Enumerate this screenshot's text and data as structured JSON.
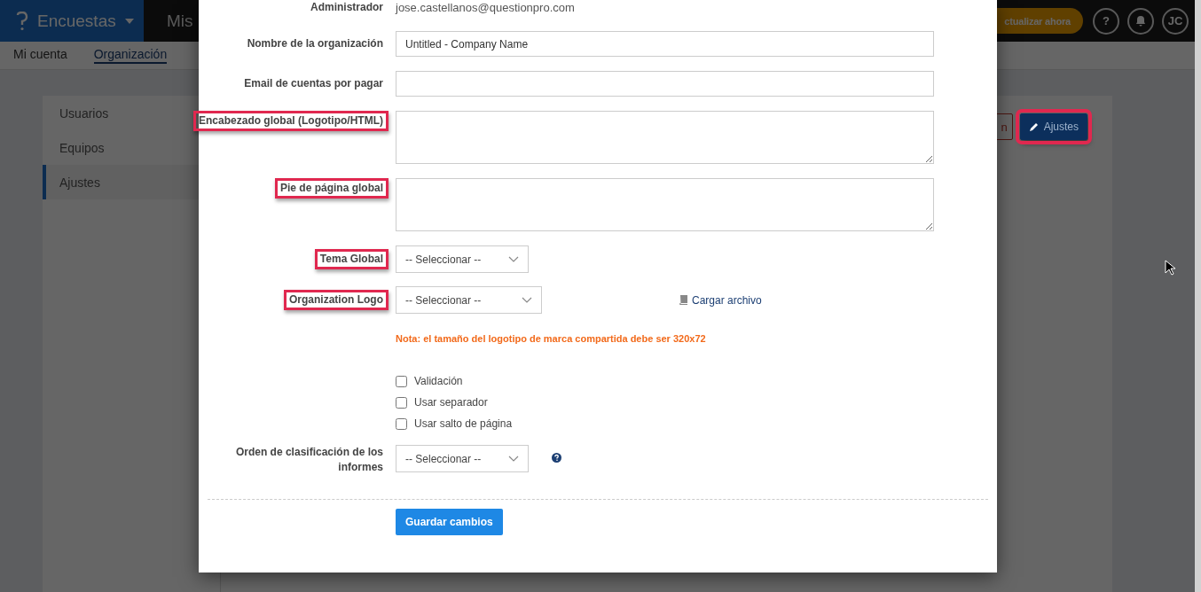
{
  "topbar": {
    "product": "Encuestas",
    "section": "Mis",
    "upgrade": "ctualizar ahora",
    "help": "?",
    "avatar": "JC"
  },
  "subnav": [
    {
      "label": "Mi cuenta",
      "selected": false
    },
    {
      "label": "Organización",
      "selected": true
    }
  ],
  "sidebar": {
    "items": [
      {
        "label": "Usuarios",
        "selected": false
      },
      {
        "label": "Equipos",
        "selected": false
      },
      {
        "label": "Ajustes",
        "selected": true
      }
    ]
  },
  "toolbar": {
    "buttons": [
      {
        "label": "n",
        "kind": "danger",
        "highlighted": false
      },
      {
        "label": "Ajustes",
        "kind": "primary",
        "highlighted": true
      }
    ]
  },
  "modal": {
    "rows": [
      {
        "kind": "static",
        "label": "Administrador",
        "value": "jose.castellanos@questionpro.com",
        "highlighted": false
      },
      {
        "kind": "text",
        "label": "Nombre de la organización",
        "value": "Untitled - Company Name",
        "highlighted": false
      },
      {
        "kind": "text",
        "label": "Email de cuentas por pagar",
        "value": "",
        "highlighted": false
      },
      {
        "kind": "textarea",
        "label": "Encabezado global (Logotipo/HTML)",
        "highlighted": true
      },
      {
        "kind": "textarea",
        "label": "Pie de página global",
        "highlighted": true
      },
      {
        "kind": "select",
        "label": "Tema Global",
        "value": "-- Seleccionar --",
        "highlighted": true
      },
      {
        "kind": "select",
        "label": "Organization Logo",
        "value": "-- Seleccionar --",
        "highlighted": true,
        "link": "Cargar archivo"
      },
      {
        "kind": "note",
        "text": "Nota: el tamaño del logotipo de marca compartida debe ser 320x72"
      },
      {
        "kind": "checkbox",
        "text": "Validación",
        "checked": false
      },
      {
        "kind": "checkbox",
        "text": "Usar separador",
        "checked": false
      },
      {
        "kind": "checkbox",
        "text": "Usar salto de página",
        "checked": false
      },
      {
        "kind": "select",
        "label": "Orden de clasificación de los informes",
        "value": "-- Seleccionar --",
        "highlighted": false,
        "help": true
      }
    ],
    "save": "Guardar cambios"
  }
}
